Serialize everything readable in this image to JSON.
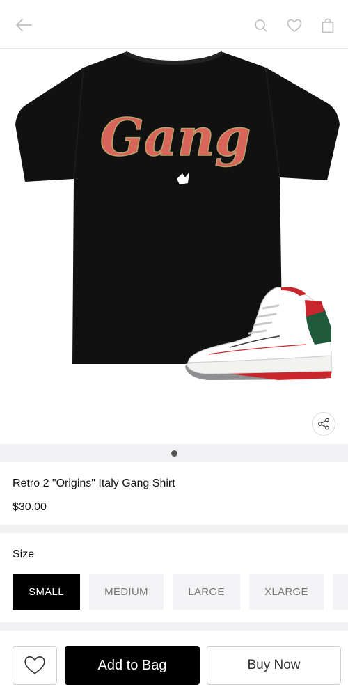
{
  "header": {
    "icons": [
      "back-arrow-icon",
      "search-icon",
      "heart-icon",
      "shopping-bag-icon"
    ]
  },
  "product": {
    "title": "Retro 2 \"Origins\" Italy Gang Shirt",
    "price": "$30.00",
    "shirt_graphic_text": "Gang",
    "image_pages": 1,
    "active_page": 1
  },
  "size": {
    "label": "Size",
    "options": [
      "SMALL",
      "MEDIUM",
      "LARGE",
      "XLARGE"
    ],
    "selected": "SMALL"
  },
  "actions": {
    "add_label": "Add to Bag",
    "buy_label": "Buy Now"
  },
  "colors": {
    "accent": "#000000",
    "shirt": "#111111",
    "logo_red": "#d9645a",
    "logo_gold": "#b7a46a",
    "sneaker_red": "#c8262d",
    "sneaker_green": "#1e5a3a"
  }
}
